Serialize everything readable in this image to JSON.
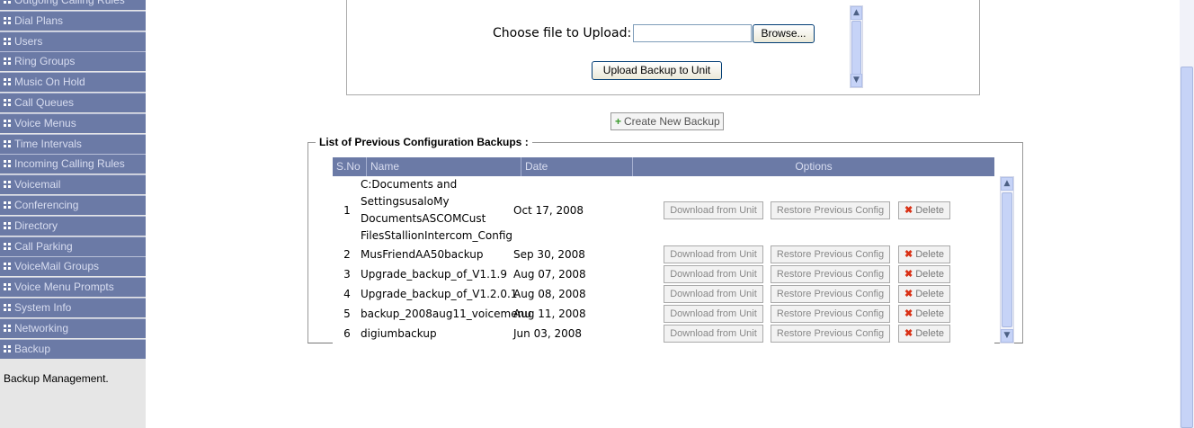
{
  "sidebar": {
    "items": [
      {
        "label": "Outgoing Calling Rules"
      },
      {
        "label": "Dial Plans"
      },
      {
        "label": "Users"
      },
      {
        "label": "Ring Groups"
      },
      {
        "label": "Music On Hold"
      },
      {
        "label": "Call Queues"
      },
      {
        "label": "Voice Menus"
      },
      {
        "label": "Time Intervals"
      },
      {
        "label": "Incoming Calling Rules"
      },
      {
        "label": "Voicemail"
      },
      {
        "label": "Conferencing"
      },
      {
        "label": "Directory"
      },
      {
        "label": "Call Parking"
      },
      {
        "label": "VoiceMail Groups"
      },
      {
        "label": "Voice Menu Prompts"
      },
      {
        "label": "System Info"
      },
      {
        "label": "Networking"
      },
      {
        "label": "Backup"
      }
    ],
    "description": "Backup Management."
  },
  "upload": {
    "label": "Choose file to Upload:",
    "file_value": "",
    "browse_label": "Browse...",
    "upload_label": "Upload Backup to Unit"
  },
  "create_backup": {
    "label": "Create New Backup",
    "icon": "plus-icon"
  },
  "backups": {
    "legend": "List of Previous Configuration Backups :",
    "columns": {
      "sno": "S.No",
      "name": "Name",
      "date": "Date",
      "options": "Options"
    },
    "rows": [
      {
        "sno": "1",
        "name_lines": [
          "C:Documents and",
          "SettingsusaloMy",
          "DocumentsASCOMCust",
          "FilesStallionIntercom_Config"
        ],
        "date": "Oct 17, 2008"
      },
      {
        "sno": "2",
        "name_lines": [
          "MusFriendAA50backup"
        ],
        "date": "Sep 30, 2008"
      },
      {
        "sno": "3",
        "name_lines": [
          "Upgrade_backup_of_V1.1.9"
        ],
        "date": "Aug 07, 2008"
      },
      {
        "sno": "4",
        "name_lines": [
          "Upgrade_backup_of_V1.2.0.1"
        ],
        "date": "Aug 08, 2008"
      },
      {
        "sno": "5",
        "name_lines": [
          "backup_2008aug11_voicemenu"
        ],
        "date": "Aug 11, 2008"
      },
      {
        "sno": "6",
        "name_lines": [
          "digiumbackup"
        ],
        "date": "Jun 03, 2008"
      }
    ],
    "options": {
      "download_label": "Download from Unit",
      "restore_label": "Restore Previous Config",
      "delete_label": "Delete"
    }
  },
  "colors": {
    "nav_bg": "#6b7aa6",
    "nav_text": "#d8ddf0",
    "sidebar_bg": "#e6e6e6",
    "delete_x": "#d93015",
    "plus": "#3a9a2c"
  }
}
